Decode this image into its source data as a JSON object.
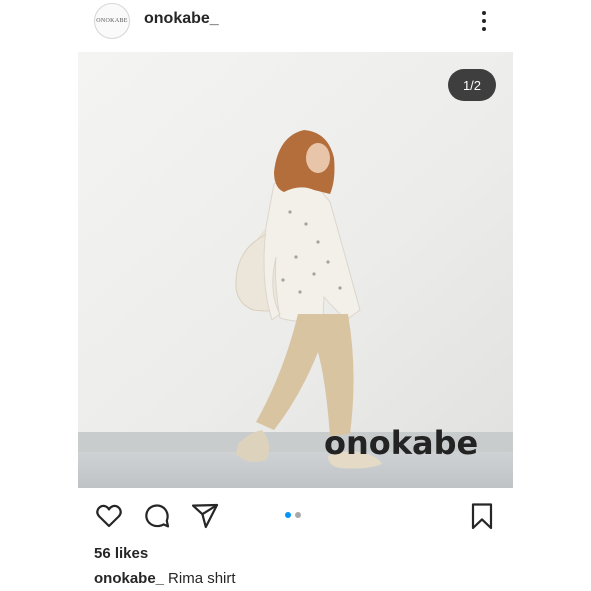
{
  "header": {
    "avatar_text": "ONOKABE",
    "username": "onokabe_",
    "more_icon": "more-vertical-icon"
  },
  "media": {
    "counter": "1/2",
    "wall_logo_text": "onokabe",
    "current_slide": 1,
    "total_slides": 2
  },
  "actions": {
    "like_icon": "heart-icon",
    "comment_icon": "comment-icon",
    "share_icon": "send-icon",
    "save_icon": "bookmark-icon",
    "accent_color": "#0095f6"
  },
  "post": {
    "likes": "56 likes",
    "caption_user": "onokabe_",
    "caption_text": "Rima shirt"
  }
}
